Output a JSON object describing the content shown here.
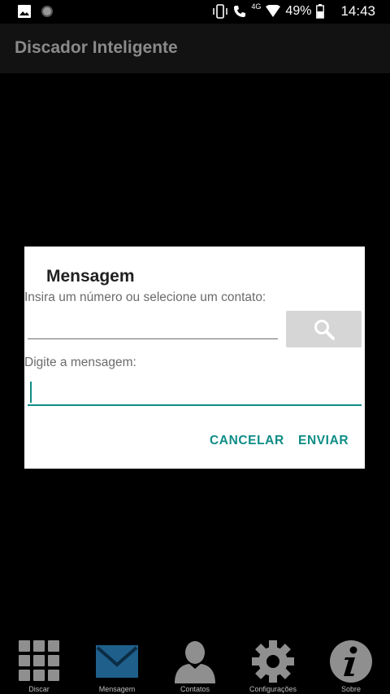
{
  "status_bar": {
    "network": "4G",
    "battery": "49%",
    "time": "14:43"
  },
  "app_bar": {
    "title": "Discador Inteligente"
  },
  "dialog": {
    "title": "Mensagem",
    "number_label": "Insira um número ou selecione um contato:",
    "number_value": "",
    "message_label": "Digite a mensagem:",
    "message_value": "",
    "cancel_label": "CANCELAR",
    "send_label": "ENVIAR"
  },
  "bottom_nav": {
    "items": [
      {
        "label": "Discar",
        "icon": "dialpad-icon"
      },
      {
        "label": "Mensagem",
        "icon": "envelope-icon"
      },
      {
        "label": "Contatos",
        "icon": "contact-icon"
      },
      {
        "label": "Configurações",
        "icon": "gear-icon"
      },
      {
        "label": "Sobre",
        "icon": "info-icon"
      }
    ]
  },
  "colors": {
    "accent": "#0f8c86",
    "selected_nav": "#1f5f8b"
  }
}
